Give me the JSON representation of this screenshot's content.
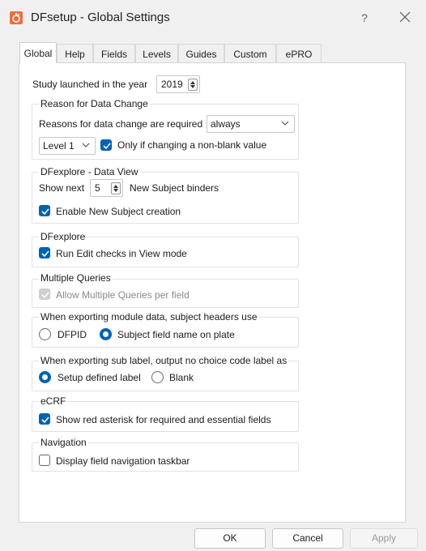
{
  "window": {
    "title": "DFsetup - Global Settings",
    "help_label": "?",
    "close_label": "✕"
  },
  "tabs": [
    {
      "label": "Global",
      "active": true
    },
    {
      "label": "Help"
    },
    {
      "label": "Fields"
    },
    {
      "label": "Levels"
    },
    {
      "label": "Guides"
    },
    {
      "label": "Custom"
    },
    {
      "label": "ePRO"
    }
  ],
  "study": {
    "label": "Study launched in the year",
    "year": "2019"
  },
  "reason": {
    "title": "Reason for Data Change",
    "required_label": "Reasons for data change are required",
    "required_value": "always",
    "level_value": "Level 1",
    "nonblank_label": "Only if changing a non-blank value",
    "nonblank_checked": true
  },
  "dataview": {
    "title": "DFexplore - Data View",
    "show_next_label": "Show next",
    "show_next_value": "5",
    "binders_label": "New Subject binders",
    "enable_label": "Enable New Subject creation",
    "enable_checked": true
  },
  "dfexplore": {
    "title": "DFexplore",
    "run_checks_label": "Run Edit checks in View mode",
    "run_checks_checked": true
  },
  "multi": {
    "title": "Multiple Queries",
    "allow_label": "Allow Multiple Queries per field",
    "allow_checked": true,
    "allow_disabled": true
  },
  "export_headers": {
    "title": "When exporting module data, subject headers use",
    "options": [
      "DFPID",
      "Subject field name on plate"
    ],
    "selected": "Subject field name on plate"
  },
  "export_sublabel": {
    "title": "When exporting sub label, output no choice code label as",
    "options": [
      "Setup defined label",
      "Blank"
    ],
    "selected": "Setup defined label"
  },
  "ecrf": {
    "title": "eCRF",
    "asterisk_label": "Show red asterisk for required and essential fields",
    "asterisk_checked": true
  },
  "navigation": {
    "title": "Navigation",
    "taskbar_label": "Display field navigation taskbar",
    "taskbar_checked": false
  },
  "footer": {
    "ok": "OK",
    "cancel": "Cancel",
    "apply": "Apply"
  },
  "colors": {
    "accent": "#0063b1",
    "app_icon": "#f26d3d"
  }
}
